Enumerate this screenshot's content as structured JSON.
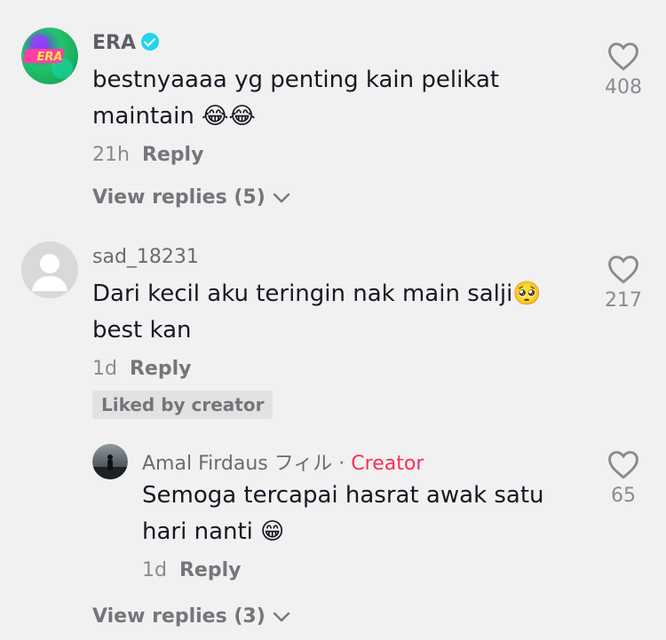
{
  "comments": [
    {
      "username": "ERA",
      "verified": true,
      "text": "bestnyaaaa yg penting kain pelikat\nmaintain 😂😂",
      "time": "21h",
      "reply_label": "Reply",
      "likes": "408",
      "view_replies": "View replies (5)",
      "avatar_text": "ERA"
    },
    {
      "username": "sad_18231",
      "text": "Dari kecil aku teringin nak main salji🥺\nbest kan",
      "time": "1d",
      "reply_label": "Reply",
      "likes": "217",
      "liked_badge": "Liked by creator"
    },
    {
      "username": "Amal Firdaus フィル",
      "separator": "·",
      "creator_tag": "Creator",
      "text": "Semoga tercapai hasrat awak satu\nhari nanti 😁",
      "time": "1d",
      "reply_label": "Reply",
      "likes": "65"
    }
  ],
  "view_replies_2": "View replies (3)",
  "colors": {
    "background": "#f1f1f1",
    "text": "#161823",
    "muted": "#8a8b91",
    "creator": "#fe2c55",
    "verified": "#20d5ec"
  },
  "icons": [
    "heart-icon",
    "chevron-down-icon",
    "verified-badge-icon"
  ]
}
